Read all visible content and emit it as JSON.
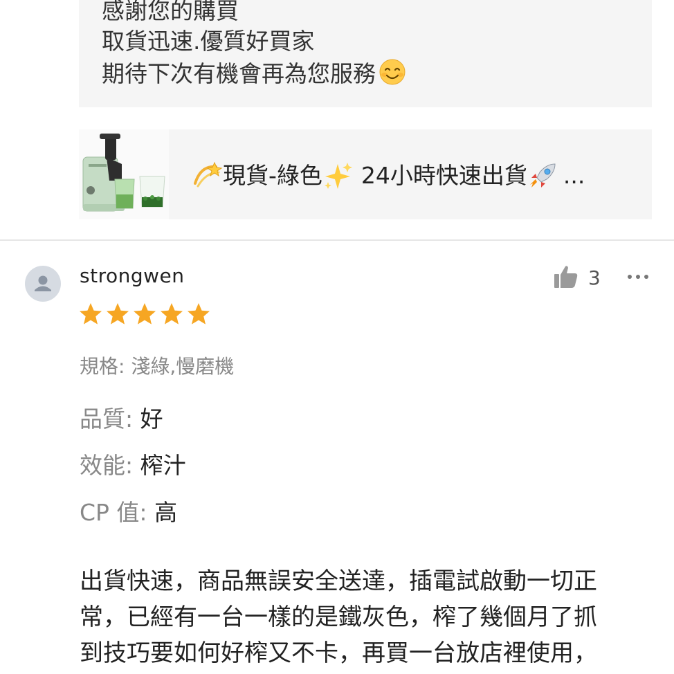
{
  "seller_reply": {
    "lines": [
      "感謝您的購買",
      "取貨迅速.優質好買家",
      "期待下次有機會再為您服務"
    ],
    "emoji": "smiling-face-icon"
  },
  "product": {
    "thumbnail": "slow-juicer-green",
    "name_prefix": "現貨-綠色",
    "name_middle": "24小時快速出貨",
    "name_suffix": "...",
    "emojis": [
      "dizzy-icon",
      "sparkles-icon",
      "rocket-icon"
    ]
  },
  "review": {
    "username": "strongwen",
    "likes": "3",
    "rating": 5,
    "rating_max": 5,
    "variation": "規格: 淺綠,慢磨機",
    "attributes": [
      {
        "key": "品質:",
        "value": "好"
      },
      {
        "key": "效能:",
        "value": "榨汁"
      },
      {
        "key": "CP 值:",
        "value": "高"
      }
    ],
    "text_lines": [
      "出貨快速，商品無誤安全送達，插電試啟動一切正",
      "常，已經有一台一樣的是鐵灰色，榨了幾個月了抓",
      "到技巧要如何好榨又不卡，再買一台放店裡使用，"
    ]
  },
  "colors": {
    "star": "#f6a623",
    "reply_bg": "#f5f5f5",
    "muted_text": "#888888",
    "icon_gray": "#999999"
  }
}
